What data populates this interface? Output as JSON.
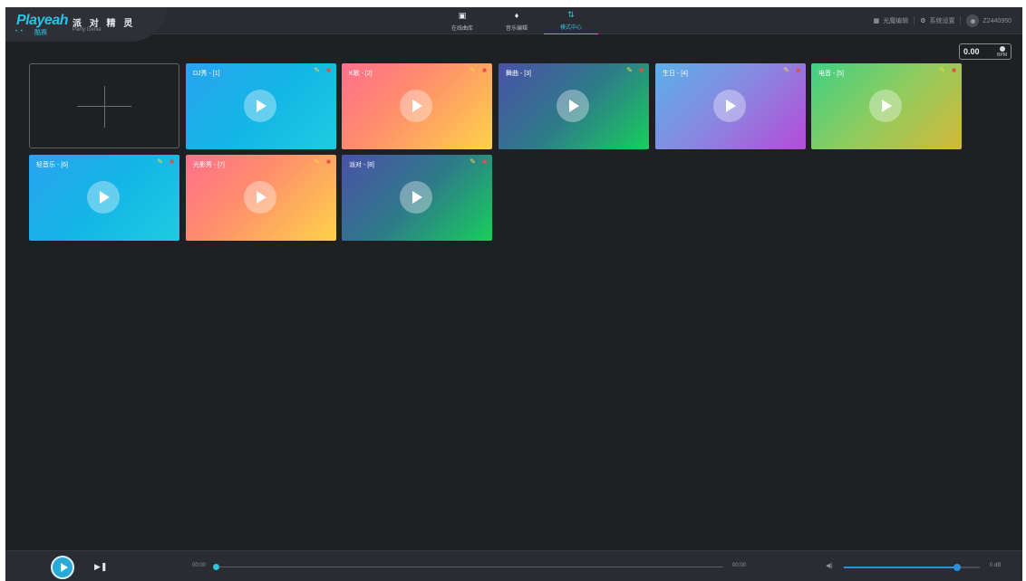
{
  "app": {
    "logo": "Playeah",
    "logo_sub": "酷赛",
    "name_cn": "派 对 精 灵",
    "name_en": "Party Genie"
  },
  "nav": {
    "tabs": [
      {
        "label": "在线曲库",
        "icon": "gift-icon"
      },
      {
        "label": "音乐编辑",
        "icon": "waveform-icon"
      },
      {
        "label": "模式中心",
        "icon": "sliders-icon",
        "active": true
      }
    ]
  },
  "toolbar": {
    "light_edit": "光魔编辑",
    "settings": "系统设置",
    "user": "Z2440950"
  },
  "bpm": {
    "value": "0.00",
    "unit": "BPM"
  },
  "modes": [
    {
      "label": "DJ秀 - [1]",
      "gradient": "blue"
    },
    {
      "label": "K歌 - [2]",
      "gradient": "coral"
    },
    {
      "label": "舞曲 - [3]",
      "gradient": "purple"
    },
    {
      "label": "生日 - [4]",
      "gradient": "violet"
    },
    {
      "label": "电音 - [5]",
      "gradient": "lime"
    },
    {
      "label": "轻音乐 - [6]",
      "gradient": "blue"
    },
    {
      "label": "光影秀 - [7]",
      "gradient": "coral"
    },
    {
      "label": "派对 - [8]",
      "gradient": "purple"
    }
  ],
  "player": {
    "current_time": "00:00",
    "total_time": "00:00",
    "progress": 0,
    "volume_percent": 83,
    "volume_label": "0 dB"
  }
}
